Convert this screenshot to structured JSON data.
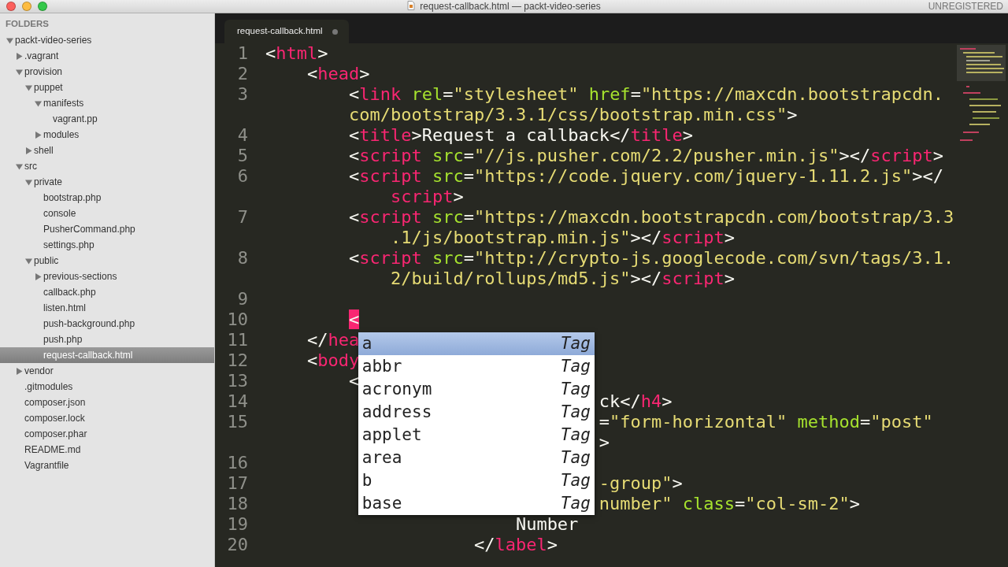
{
  "window": {
    "title": "request-callback.html — packt-video-series",
    "license": "UNREGISTERED"
  },
  "sidebar": {
    "header": "FOLDERS",
    "items": [
      {
        "label": "packt-video-series",
        "kind": "folder",
        "expanded": true,
        "selected": false,
        "children": [
          {
            "label": ".vagrant",
            "kind": "folder",
            "expanded": false,
            "selected": false
          },
          {
            "label": "provision",
            "kind": "folder",
            "expanded": true,
            "selected": false,
            "children": [
              {
                "label": "puppet",
                "kind": "folder",
                "expanded": true,
                "selected": false,
                "children": [
                  {
                    "label": "manifests",
                    "kind": "folder",
                    "expanded": true,
                    "selected": false,
                    "children": [
                      {
                        "label": "vagrant.pp",
                        "kind": "file",
                        "selected": false
                      }
                    ]
                  },
                  {
                    "label": "modules",
                    "kind": "folder",
                    "expanded": false,
                    "selected": false
                  }
                ]
              },
              {
                "label": "shell",
                "kind": "folder",
                "expanded": false,
                "selected": false
              }
            ]
          },
          {
            "label": "src",
            "kind": "folder",
            "expanded": true,
            "selected": false,
            "children": [
              {
                "label": "private",
                "kind": "folder",
                "expanded": true,
                "selected": false,
                "children": [
                  {
                    "label": "bootstrap.php",
                    "kind": "file",
                    "selected": false
                  },
                  {
                    "label": "console",
                    "kind": "file",
                    "selected": false
                  },
                  {
                    "label": "PusherCommand.php",
                    "kind": "file",
                    "selected": false
                  },
                  {
                    "label": "settings.php",
                    "kind": "file",
                    "selected": false
                  }
                ]
              },
              {
                "label": "public",
                "kind": "folder",
                "expanded": true,
                "selected": false,
                "children": [
                  {
                    "label": "previous-sections",
                    "kind": "folder",
                    "expanded": false,
                    "selected": false
                  },
                  {
                    "label": "callback.php",
                    "kind": "file",
                    "selected": false
                  },
                  {
                    "label": "listen.html",
                    "kind": "file",
                    "selected": false
                  },
                  {
                    "label": "push-background.php",
                    "kind": "file",
                    "selected": false
                  },
                  {
                    "label": "push.php",
                    "kind": "file",
                    "selected": false
                  },
                  {
                    "label": "request-callback.html",
                    "kind": "file",
                    "selected": true
                  }
                ]
              }
            ]
          },
          {
            "label": "vendor",
            "kind": "folder",
            "expanded": false,
            "selected": false
          },
          {
            "label": ".gitmodules",
            "kind": "file",
            "selected": false
          },
          {
            "label": "composer.json",
            "kind": "file",
            "selected": false
          },
          {
            "label": "composer.lock",
            "kind": "file",
            "selected": false
          },
          {
            "label": "composer.phar",
            "kind": "file",
            "selected": false
          },
          {
            "label": "README.md",
            "kind": "file",
            "selected": false
          },
          {
            "label": "Vagrantfile",
            "kind": "file",
            "selected": false
          }
        ]
      }
    ]
  },
  "tabs": [
    {
      "label": "request-callback.html",
      "selected": true,
      "modified": true
    }
  ],
  "editor": {
    "lines": [
      {
        "number": "1",
        "rows": [
          {
            "indent": "",
            "tokens": [
              {
                "kind": "punct",
                "text": "<"
              },
              {
                "kind": "tag",
                "text": "html"
              },
              {
                "kind": "punct",
                "text": ">"
              }
            ]
          }
        ]
      },
      {
        "number": "2",
        "rows": [
          {
            "indent": "    ",
            "tokens": [
              {
                "kind": "punct",
                "text": "<"
              },
              {
                "kind": "tag",
                "text": "head"
              },
              {
                "kind": "punct",
                "text": ">"
              }
            ]
          }
        ]
      },
      {
        "number": "3",
        "rows": [
          {
            "indent": "        ",
            "tokens": [
              {
                "kind": "punct",
                "text": "<"
              },
              {
                "kind": "tag",
                "text": "link"
              },
              {
                "kind": "attr",
                "text": " rel"
              },
              {
                "kind": "punct",
                "text": "="
              },
              {
                "kind": "string",
                "text": "\"stylesheet\""
              },
              {
                "kind": "attr",
                "text": " href"
              },
              {
                "kind": "punct",
                "text": "="
              },
              {
                "kind": "string",
                "text": "\"https://maxcdn.bootstrapcdn."
              }
            ]
          },
          {
            "indent": "        ",
            "tokens": [
              {
                "kind": "string",
                "text": "com/bootstrap/3.3.1/css/bootstrap.min.css\""
              },
              {
                "kind": "punct",
                "text": ">"
              }
            ]
          }
        ]
      },
      {
        "number": "4",
        "rows": [
          {
            "indent": "        ",
            "tokens": [
              {
                "kind": "punct",
                "text": "<"
              },
              {
                "kind": "tag",
                "text": "title"
              },
              {
                "kind": "punct",
                "text": ">"
              },
              {
                "kind": "text",
                "text": "Request a callback"
              },
              {
                "kind": "punct",
                "text": "</"
              },
              {
                "kind": "tag",
                "text": "title"
              },
              {
                "kind": "punct",
                "text": ">"
              }
            ]
          }
        ]
      },
      {
        "number": "5",
        "rows": [
          {
            "indent": "        ",
            "tokens": [
              {
                "kind": "punct",
                "text": "<"
              },
              {
                "kind": "tag",
                "text": "script"
              },
              {
                "kind": "attr",
                "text": " src"
              },
              {
                "kind": "punct",
                "text": "="
              },
              {
                "kind": "string",
                "text": "\"//js.pusher.com/2.2/pusher.min.js\""
              },
              {
                "kind": "punct",
                "text": "></"
              },
              {
                "kind": "tag",
                "text": "script"
              },
              {
                "kind": "punct",
                "text": ">"
              }
            ]
          }
        ]
      },
      {
        "number": "6",
        "rows": [
          {
            "indent": "        ",
            "tokens": [
              {
                "kind": "punct",
                "text": "<"
              },
              {
                "kind": "tag",
                "text": "script"
              },
              {
                "kind": "attr",
                "text": " src"
              },
              {
                "kind": "punct",
                "text": "="
              },
              {
                "kind": "string",
                "text": "\"https://code.jquery.com/jquery-1.11.2.js\""
              },
              {
                "kind": "punct",
                "text": "></"
              }
            ]
          },
          {
            "indent": "            ",
            "tokens": [
              {
                "kind": "tag",
                "text": "script"
              },
              {
                "kind": "punct",
                "text": ">"
              }
            ]
          }
        ]
      },
      {
        "number": "7",
        "rows": [
          {
            "indent": "        ",
            "tokens": [
              {
                "kind": "punct",
                "text": "<"
              },
              {
                "kind": "tag",
                "text": "script"
              },
              {
                "kind": "attr",
                "text": " src"
              },
              {
                "kind": "punct",
                "text": "="
              },
              {
                "kind": "string",
                "text": "\"https://maxcdn.bootstrapcdn.com/bootstrap/3.3"
              }
            ]
          },
          {
            "indent": "            ",
            "tokens": [
              {
                "kind": "string",
                "text": ".1/js/bootstrap.min.js\""
              },
              {
                "kind": "punct",
                "text": "></"
              },
              {
                "kind": "tag",
                "text": "script"
              },
              {
                "kind": "punct",
                "text": ">"
              }
            ]
          }
        ]
      },
      {
        "number": "8",
        "rows": [
          {
            "indent": "        ",
            "tokens": [
              {
                "kind": "punct",
                "text": "<"
              },
              {
                "kind": "tag",
                "text": "script"
              },
              {
                "kind": "attr",
                "text": " src"
              },
              {
                "kind": "punct",
                "text": "="
              },
              {
                "kind": "string",
                "text": "\"http://crypto-js.googlecode.com/svn/tags/3.1."
              }
            ]
          },
          {
            "indent": "            ",
            "tokens": [
              {
                "kind": "string",
                "text": "2/build/rollups/md5.js\""
              },
              {
                "kind": "punct",
                "text": "></"
              },
              {
                "kind": "tag",
                "text": "script"
              },
              {
                "kind": "punct",
                "text": ">"
              }
            ]
          }
        ]
      },
      {
        "number": "9"
      },
      {
        "number": "10",
        "rows": [
          {
            "indent": "        ",
            "tokens": [
              {
                "kind": "invalid",
                "text": "<"
              }
            ]
          }
        ]
      },
      {
        "number": "11",
        "rows": [
          {
            "indent": "    ",
            "tokens": [
              {
                "kind": "punct",
                "text": "</"
              },
              {
                "kind": "tag",
                "text": "hea"
              }
            ]
          }
        ]
      },
      {
        "number": "12",
        "rows": [
          {
            "indent": "    ",
            "tokens": [
              {
                "kind": "punct",
                "text": "<"
              },
              {
                "kind": "tag",
                "text": "body"
              }
            ]
          }
        ]
      },
      {
        "number": "13",
        "rows": [
          {
            "indent": "        ",
            "tokens": [
              {
                "kind": "punct",
                "text": "<"
              }
            ]
          }
        ]
      },
      {
        "number": "14",
        "rows": [
          {
            "indent": "                                ",
            "tokens": [
              {
                "kind": "text",
                "text": "ck"
              },
              {
                "kind": "punct",
                "text": "</"
              },
              {
                "kind": "tag",
                "text": "h4"
              },
              {
                "kind": "punct",
                "text": ">"
              }
            ]
          }
        ]
      },
      {
        "number": "15",
        "rows": [
          {
            "indent": "                                ",
            "tokens": [
              {
                "kind": "punct",
                "text": "="
              },
              {
                "kind": "string",
                "text": "\"form-horizontal\""
              },
              {
                "kind": "attr",
                "text": " method"
              },
              {
                "kind": "punct",
                "text": "="
              },
              {
                "kind": "string",
                "text": "\"post\""
              }
            ]
          },
          {
            "indent": "                                ",
            "tokens": [
              {
                "kind": "punct",
                "text": ">"
              }
            ]
          }
        ]
      },
      {
        "number": "16"
      },
      {
        "number": "17",
        "rows": [
          {
            "indent": "                                ",
            "tokens": [
              {
                "kind": "string",
                "text": "-group\""
              },
              {
                "kind": "punct",
                "text": ">"
              }
            ]
          }
        ]
      },
      {
        "number": "18",
        "rows": [
          {
            "indent": "                                ",
            "tokens": [
              {
                "kind": "string",
                "text": "number\""
              },
              {
                "kind": "attr",
                "text": " class"
              },
              {
                "kind": "punct",
                "text": "="
              },
              {
                "kind": "string",
                "text": "\"col-sm-2\""
              },
              {
                "kind": "punct",
                "text": ">"
              }
            ]
          }
        ]
      },
      {
        "number": "19",
        "rows": [
          {
            "indent": "                        ",
            "tokens": [
              {
                "kind": "text",
                "text": "Number"
              }
            ]
          }
        ]
      },
      {
        "number": "20",
        "rows": [
          {
            "indent": "                    ",
            "tokens": [
              {
                "kind": "punct",
                "text": "</"
              },
              {
                "kind": "tag",
                "text": "label"
              },
              {
                "kind": "punct",
                "text": ">"
              }
            ]
          }
        ]
      }
    ]
  },
  "autocomplete": {
    "items": [
      {
        "label": "a",
        "type": "Tag",
        "selected": true
      },
      {
        "label": "abbr",
        "type": "Tag",
        "selected": false
      },
      {
        "label": "acronym",
        "type": "Tag",
        "selected": false
      },
      {
        "label": "address",
        "type": "Tag",
        "selected": false
      },
      {
        "label": "applet",
        "type": "Tag",
        "selected": false
      },
      {
        "label": "area",
        "type": "Tag",
        "selected": false
      },
      {
        "label": "b",
        "type": "Tag",
        "selected": false
      },
      {
        "label": "base",
        "type": "Tag",
        "selected": false
      }
    ]
  }
}
